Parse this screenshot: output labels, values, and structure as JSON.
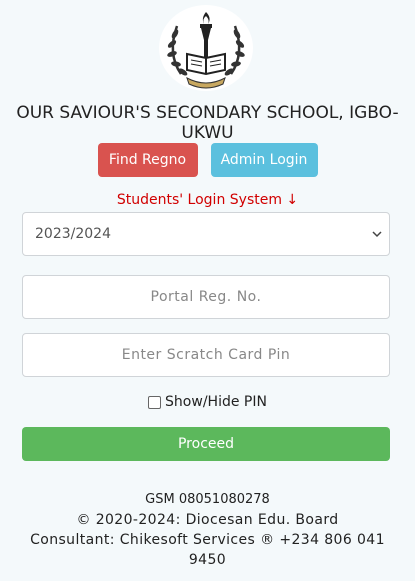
{
  "header": {
    "logo_icon": "school-crest-torch-book",
    "school_name": "OUR SAVIOUR'S SECONDARY SCHOOL, IGBO-UKWU"
  },
  "actions": {
    "find_regno_label": "Find Regno",
    "admin_login_label": "Admin Login"
  },
  "login": {
    "title": "Students' Login System ↓",
    "session_selected": "2023/2024",
    "reg_placeholder": "Portal Reg. No.",
    "pin_placeholder": "Enter Scratch Card Pin",
    "show_hide_label": "Show/Hide PIN",
    "proceed_label": "Proceed"
  },
  "footer": {
    "gsm": "GSM 08051080278",
    "copyright": "© 2020-2024: Diocesan Edu. Board",
    "consultant": "Consultant: Chikesoft Services ® +234 806 041 9450"
  },
  "colors": {
    "find_button": "#d9534f",
    "admin_button": "#5bc0de",
    "proceed_button": "#5cb85c",
    "title_red": "#d10000"
  }
}
